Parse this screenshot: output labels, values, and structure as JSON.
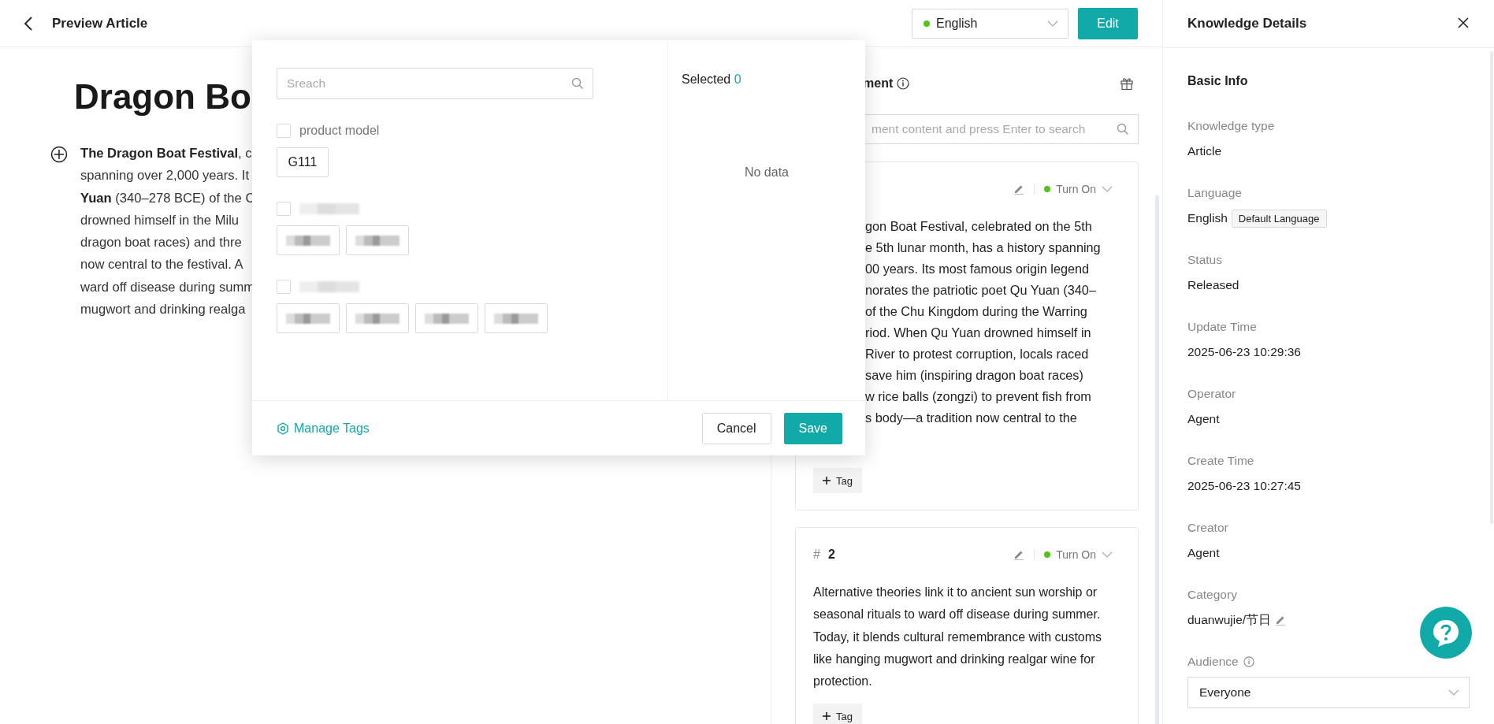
{
  "header": {
    "title": "Preview Article",
    "language": {
      "value": "English",
      "color": "#52c41a"
    },
    "edit_button": "Edit"
  },
  "article": {
    "title": "Dragon Bo",
    "lines": [
      "**The Dragon Boat Festival**, c",
      "spanning over 2,000 years. It",
      "**Yuan** (340–278 BCE) of the C",
      "drowned himself in the Milu",
      "dragon boat races) and thre",
      "now central to the festival. A",
      "ward off disease during summ",
      "mugwort and drinking realga"
    ]
  },
  "segment_panel": {
    "title": "ment",
    "search": {
      "placeholder": "ment content and press Enter to search"
    },
    "segments": [
      {
        "kind": "partial",
        "lines": [
          "gon Boat Festival, celebrated on the 5th",
          "e 5th lunar month, has a history spanning",
          "00 years. Its most famous origin legend",
          "norates the patriotic poet Qu Yuan (340–",
          "of the Chu Kingdom during the Warring",
          "riod. When Qu Yuan drowned himself in",
          "River to protest corruption, locals raced",
          "save him (inspiring dragon boat races)",
          "w rice balls (zongzi) to prevent fish from",
          "s body—a tradition now central to the"
        ],
        "status": {
          "label": "Turn On",
          "color": "#52c41a"
        },
        "tag_button": "Tag"
      },
      {
        "kind": "full",
        "hash": "#",
        "number": "2",
        "text": "Alternative theories link it to ancient sun worship or seasonal rituals to ward off disease during summer. Today, it blends cultural remembrance with customs like hanging mugwort and drinking realgar wine for protection.",
        "status": {
          "label": "Turn On",
          "color": "#52c41a"
        },
        "tag_button": "Tag"
      }
    ]
  },
  "details": {
    "title": "Knowledge Details",
    "section": "Basic Info",
    "fields": [
      {
        "label": "Knowledge type",
        "value": "Article",
        "editable": false
      },
      {
        "label": "Language",
        "value": "English",
        "badge": "Default Language",
        "editable": false
      },
      {
        "label": "Status",
        "value": "Released",
        "editable": false
      },
      {
        "label": "Update Time",
        "value": "2025-06-23 10:29:36",
        "editable": false
      },
      {
        "label": "Operator",
        "value": "Agent",
        "editable": false
      },
      {
        "label": "Create Time",
        "value": "2025-06-23 10:27:45",
        "editable": false
      },
      {
        "label": "Creator",
        "value": "Agent",
        "editable": false
      },
      {
        "label": "Category",
        "value": "duanwujie/节日",
        "editable": true
      }
    ],
    "audience": {
      "label": "Audience",
      "value": "Everyone"
    }
  },
  "tag_dialog": {
    "search": {
      "placeholder": "Sreach"
    },
    "groups": [
      {
        "kind": "text",
        "label": "product model",
        "checked": false,
        "tags": [
          {
            "kind": "text",
            "text": "G111"
          }
        ]
      },
      {
        "kind": "redacted",
        "checked": false,
        "tags": [
          {
            "kind": "redacted"
          },
          {
            "kind": "redacted"
          }
        ]
      },
      {
        "kind": "redacted",
        "checked": false,
        "tags": [
          {
            "kind": "redacted"
          },
          {
            "kind": "redacted"
          },
          {
            "kind": "redacted"
          },
          {
            "kind": "redacted"
          }
        ]
      }
    ],
    "selected": {
      "label": "Selected",
      "count": "0"
    },
    "empty": "No data",
    "manage_link": "Manage Tags",
    "buttons": [
      {
        "label": "Cancel",
        "kind": "default"
      },
      {
        "label": "Save",
        "kind": "primary"
      }
    ]
  }
}
